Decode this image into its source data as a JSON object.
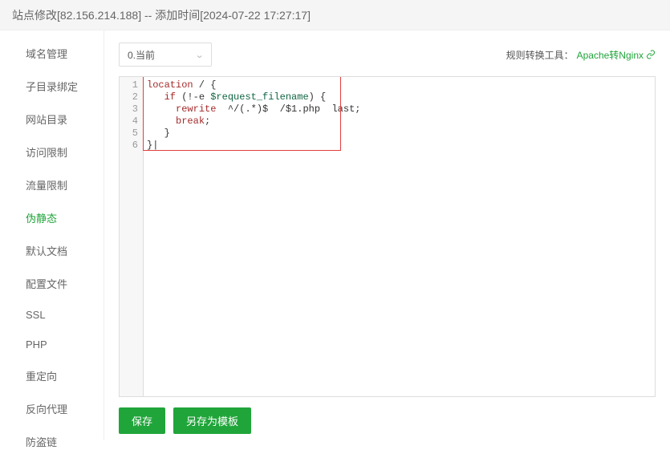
{
  "header": {
    "title": "站点修改[82.156.214.188] -- 添加时间[2024-07-22 17:27:17]"
  },
  "sidebar": {
    "items": [
      {
        "label": "域名管理"
      },
      {
        "label": "子目录绑定"
      },
      {
        "label": "网站目录"
      },
      {
        "label": "访问限制"
      },
      {
        "label": "流量限制"
      },
      {
        "label": "伪静态"
      },
      {
        "label": "默认文档"
      },
      {
        "label": "配置文件"
      },
      {
        "label": "SSL"
      },
      {
        "label": "PHP"
      },
      {
        "label": "重定向"
      },
      {
        "label": "反向代理"
      },
      {
        "label": "防盗链"
      }
    ],
    "active_index": 5
  },
  "topbar": {
    "select_value": "0.当前",
    "tool_label": "规则转换工具：",
    "tool_link": "Apache转Nginx"
  },
  "code": {
    "lines": [
      {
        "num": "1",
        "tokens": [
          {
            "c": "hl-red",
            "t": "location"
          },
          {
            "t": " / {"
          }
        ]
      },
      {
        "num": "2",
        "tokens": [
          {
            "t": "   "
          },
          {
            "c": "hl-red",
            "t": "if"
          },
          {
            "t": " (!-e "
          },
          {
            "c": "hl-green",
            "t": "$request_filename"
          },
          {
            "t": ") {"
          }
        ]
      },
      {
        "num": "3",
        "tokens": [
          {
            "t": "     "
          },
          {
            "c": "hl-red",
            "t": "rewrite"
          },
          {
            "t": "  ^/(.*)$  /$1.php  last;"
          }
        ]
      },
      {
        "num": "4",
        "tokens": [
          {
            "t": "     "
          },
          {
            "c": "hl-red",
            "t": "break"
          },
          {
            "t": ";"
          }
        ]
      },
      {
        "num": "5",
        "tokens": [
          {
            "t": "   }"
          }
        ]
      },
      {
        "num": "6",
        "tokens": [
          {
            "t": "}"
          },
          {
            "c": "cursor",
            "t": "|"
          }
        ]
      }
    ]
  },
  "buttons": {
    "save": "保存",
    "save_as": "另存为模板"
  },
  "colors": {
    "accent": "#20a53a"
  }
}
